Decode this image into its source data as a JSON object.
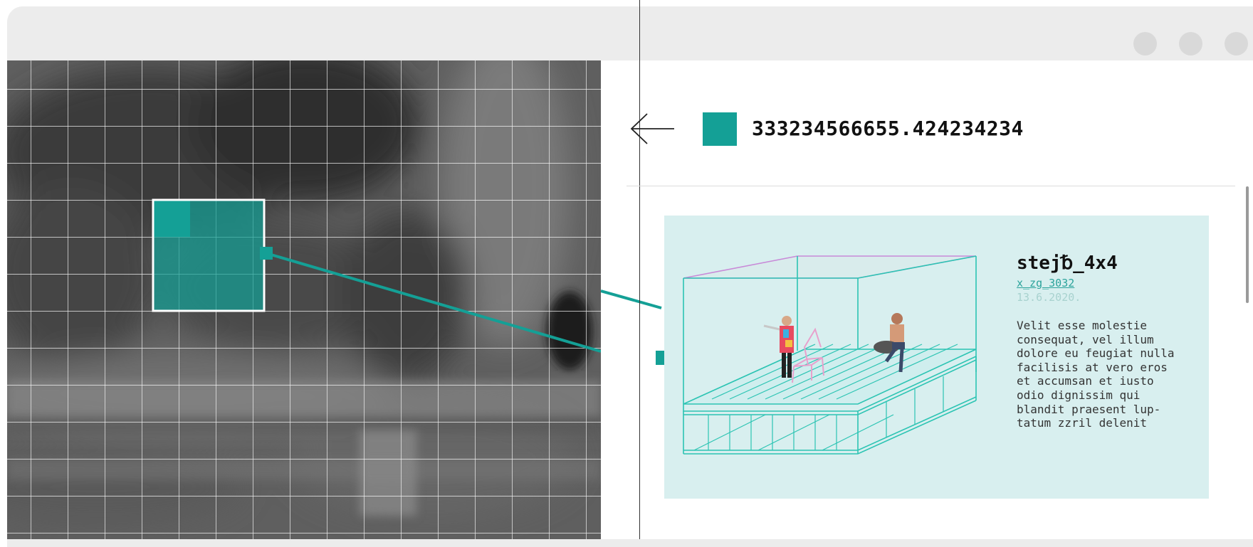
{
  "window": {
    "buttons": [
      "window-button-1",
      "window-button-2",
      "window-button-3"
    ]
  },
  "header": {
    "back_icon": "arrow-left-icon",
    "value": "333234566655.424234234"
  },
  "card": {
    "title": "stej␢_4x4",
    "link": "x_zg_3032",
    "date": "13.6.2020.",
    "description": "Velit esse molestie\nconsequat, vel illum\ndolore eu feugiat nulla\nfacilisis at vero eros\net accumsan et iusto\nodio dignissim qui\nblandit praesent lup-\ntatum zzril delenit"
  },
  "colors": {
    "accent": "#14a096",
    "card_background": "#d8efef",
    "link": "#2aa39b"
  }
}
